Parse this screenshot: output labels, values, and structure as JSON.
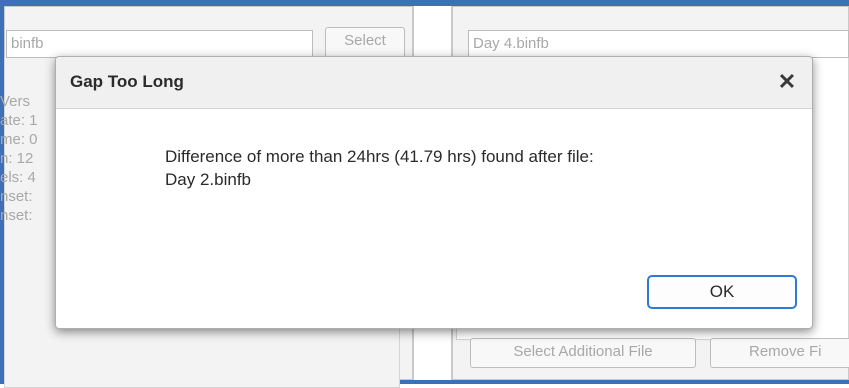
{
  "background": {
    "left_field_value": "binfb",
    "select_button_label": "Select",
    "info_lines": [
      "Vers",
      "ate: 1",
      "me: 0",
      "n: 12",
      "els: 4",
      "nset:",
      "nset:"
    ],
    "right_field_value": "Day 4.binfb",
    "select_additional_label": "Select Additional File",
    "remove_label": "Remove Fi"
  },
  "dialog": {
    "title": "Gap Too Long",
    "close_glyph": "✕",
    "message_line1": "Difference of more than 24hrs (41.79 hrs) found after file:",
    "message_line2": "Day 2.binfb",
    "ok_label": "OK"
  },
  "colors": {
    "frame_accent": "#3f6fb6",
    "ok_border": "#2f7bd4"
  }
}
